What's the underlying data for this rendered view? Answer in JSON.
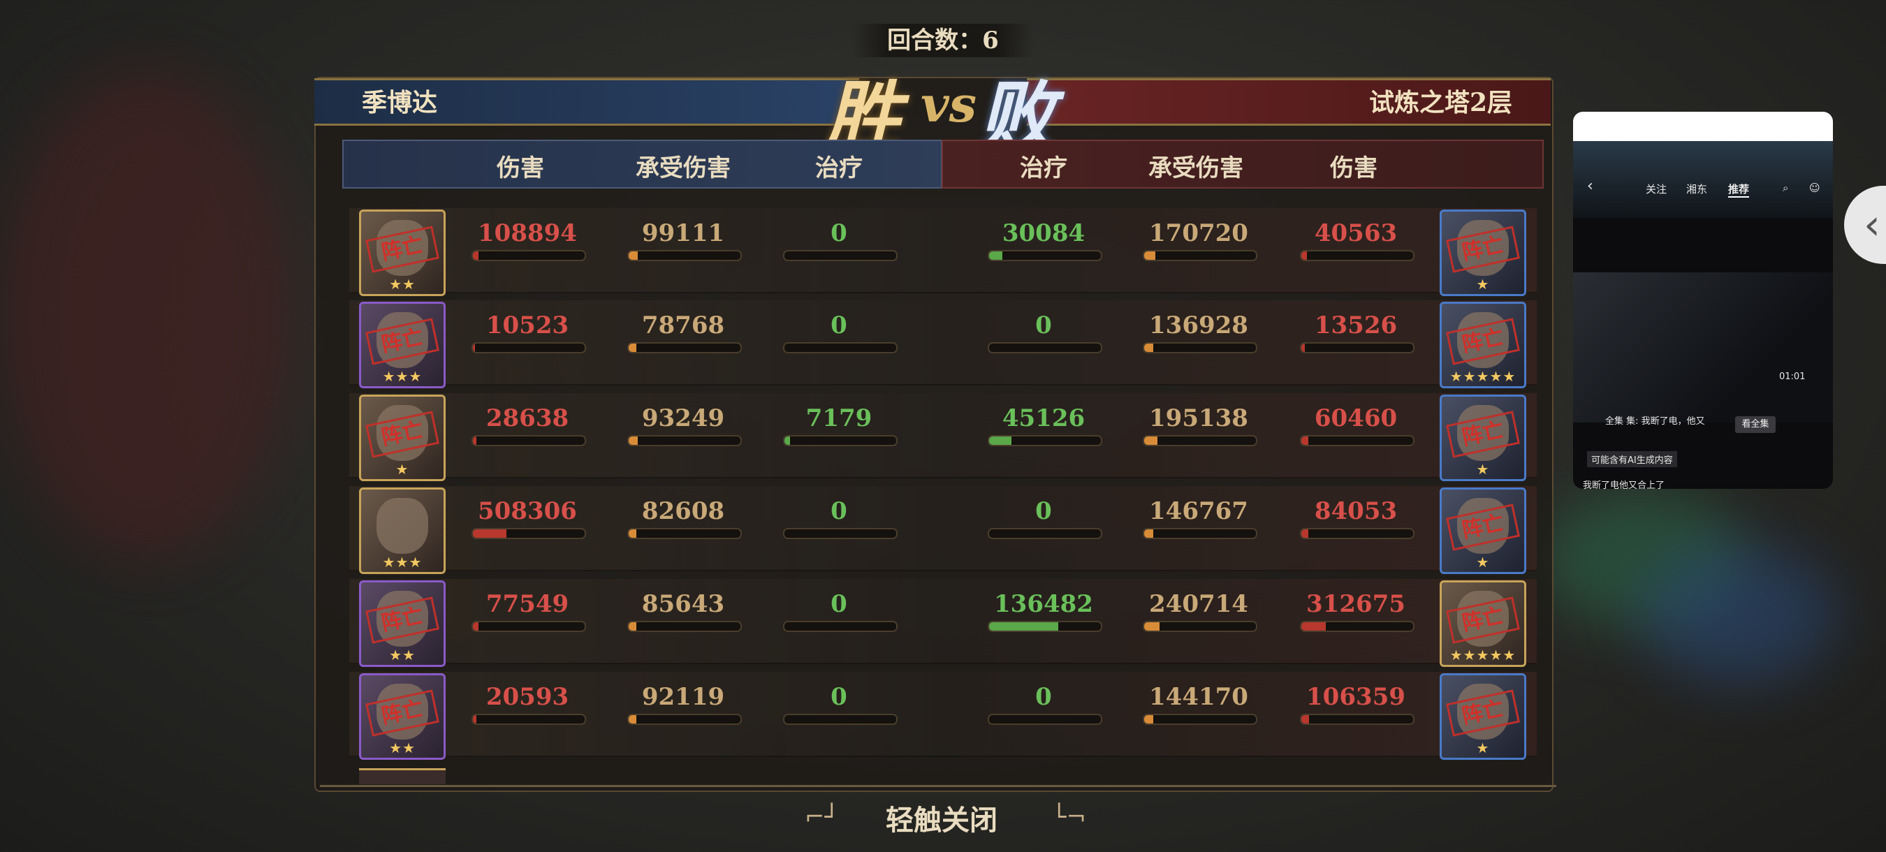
{
  "round": {
    "text": "回合数：6"
  },
  "header": {
    "left_name": "季博达",
    "right_name": "试炼之塔2层",
    "win_text": "胜",
    "vs_text": "vs",
    "lose_text": "败"
  },
  "columns": {
    "left": [
      "伤害",
      "承受伤害",
      "治疗"
    ],
    "right": [
      "治疗",
      "承受伤害",
      "伤害"
    ]
  },
  "defeat_stamp": "阵亡",
  "rows": [
    {
      "left_frame": "gold",
      "left_stars": "★★",
      "left_defeated": true,
      "l_damage": "108894",
      "l_damage_frac": 0.05,
      "l_taken": "99111",
      "l_taken_frac": 0.08,
      "l_heal": "0",
      "l_heal_frac": 0,
      "r_heal": "30084",
      "r_heal_frac": 0.12,
      "r_taken": "170720",
      "r_taken_frac": 0.1,
      "r_damage": "40563",
      "r_damage_frac": 0.05,
      "right_frame": "blue",
      "right_stars": "★",
      "right_defeated": true
    },
    {
      "left_frame": "purple",
      "left_stars": "★★★",
      "left_defeated": true,
      "l_damage": "10523",
      "l_damage_frac": 0.02,
      "l_taken": "78768",
      "l_taken_frac": 0.07,
      "l_heal": "0",
      "l_heal_frac": 0,
      "r_heal": "0",
      "r_heal_frac": 0,
      "r_taken": "136928",
      "r_taken_frac": 0.08,
      "r_damage": "13526",
      "r_damage_frac": 0.03,
      "right_frame": "blue",
      "right_stars": "★★★★★",
      "right_defeated": true
    },
    {
      "left_frame": "gold",
      "left_stars": "★",
      "left_defeated": true,
      "l_damage": "28638",
      "l_damage_frac": 0.03,
      "l_taken": "93249",
      "l_taken_frac": 0.08,
      "l_heal": "7179",
      "l_heal_frac": 0.05,
      "r_heal": "45126",
      "r_heal_frac": 0.2,
      "r_taken": "195138",
      "r_taken_frac": 0.12,
      "r_damage": "60460",
      "r_damage_frac": 0.06,
      "right_frame": "blue",
      "right_stars": "★",
      "right_defeated": true
    },
    {
      "left_frame": "gold",
      "left_stars": "★★★",
      "left_defeated": false,
      "l_damage": "508306",
      "l_damage_frac": 0.3,
      "l_taken": "82608",
      "l_taken_frac": 0.07,
      "l_heal": "0",
      "l_heal_frac": 0,
      "r_heal": "0",
      "r_heal_frac": 0,
      "r_taken": "146767",
      "r_taken_frac": 0.08,
      "r_damage": "84053",
      "r_damage_frac": 0.06,
      "right_frame": "blue",
      "right_stars": "★",
      "right_defeated": true
    },
    {
      "left_frame": "purple",
      "left_stars": "★★",
      "left_defeated": true,
      "l_damage": "77549",
      "l_damage_frac": 0.05,
      "l_taken": "85643",
      "l_taken_frac": 0.07,
      "l_heal": "0",
      "l_heal_frac": 0,
      "r_heal": "136482",
      "r_heal_frac": 0.62,
      "r_taken": "240714",
      "r_taken_frac": 0.14,
      "r_damage": "312675",
      "r_damage_frac": 0.22,
      "right_frame": "gold",
      "right_stars": "★★★★★",
      "right_defeated": true
    },
    {
      "left_frame": "purple",
      "left_stars": "★★",
      "left_defeated": true,
      "l_damage": "20593",
      "l_damage_frac": 0.03,
      "l_taken": "92119",
      "l_taken_frac": 0.07,
      "l_heal": "0",
      "l_heal_frac": 0,
      "r_heal": "0",
      "r_heal_frac": 0,
      "r_taken": "144170",
      "r_taken_frac": 0.08,
      "r_damage": "106359",
      "r_damage_frac": 0.07,
      "right_frame": "blue",
      "right_stars": "★",
      "right_defeated": true
    }
  ],
  "close_label": "轻触关闭",
  "overlay": {
    "tab_follow": "关注",
    "tab_recommend": "推荐",
    "tab_other": "湘东",
    "caption_top": "全集 集: 我断了电，他又",
    "watch_full": "看全集",
    "time": "01:01",
    "ai_note": "可能含有AI生成内容",
    "caption_bottom": "我断了电他又合上了"
  }
}
